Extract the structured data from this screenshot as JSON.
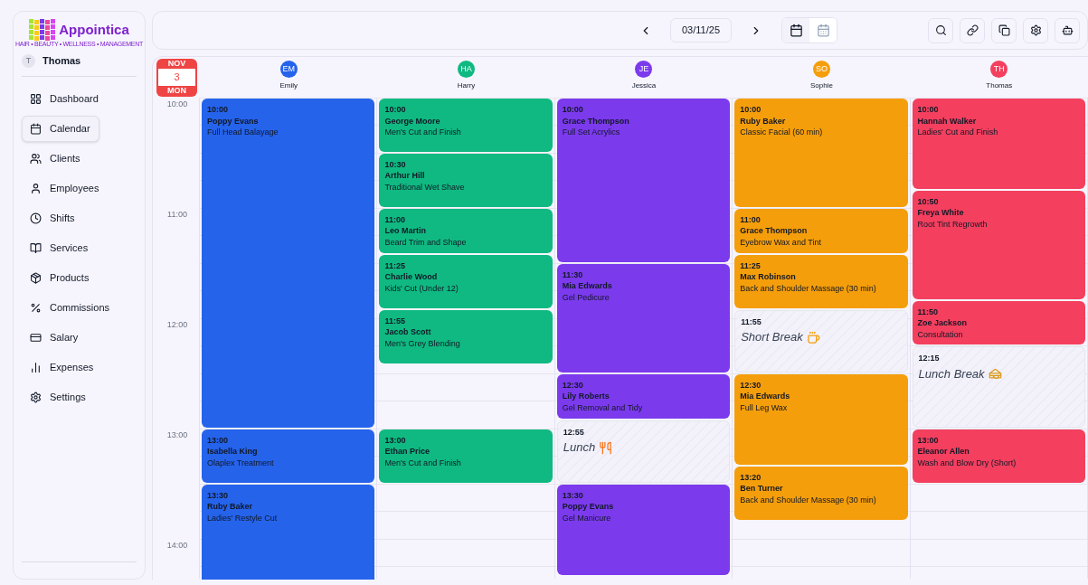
{
  "brand": {
    "name": "Appointica",
    "tagline": "HAIR • BEAUTY • WELLNESS • MANAGEMENT"
  },
  "user": {
    "initial": "T",
    "name": "Thomas"
  },
  "nav": [
    {
      "label": "Dashboard",
      "selected": false
    },
    {
      "label": "Calendar",
      "selected": true
    },
    {
      "label": "Clients",
      "selected": false
    },
    {
      "label": "Employees",
      "selected": false
    },
    {
      "label": "Shifts",
      "selected": false
    },
    {
      "label": "Services",
      "selected": false
    },
    {
      "label": "Products",
      "selected": false
    },
    {
      "label": "Commissions",
      "selected": false
    },
    {
      "label": "Salary",
      "selected": false
    },
    {
      "label": "Expenses",
      "selected": false
    },
    {
      "label": "Settings",
      "selected": false
    }
  ],
  "toolbar": {
    "date": "03/11/25",
    "views": [
      {
        "kind": "day",
        "selected": true
      },
      {
        "kind": "month",
        "selected": false
      }
    ]
  },
  "day_badge": {
    "month": "NOV",
    "day": "3",
    "weekday": "MON"
  },
  "hours": [
    "10:00",
    "11:00",
    "12:00",
    "13:00",
    "14:00"
  ],
  "employees": [
    {
      "initials": "EM",
      "name": "Emily",
      "color": "#2563eb",
      "events": [
        {
          "kind": "appointment",
          "time": "10:00",
          "client": "Poppy Evans",
          "service": "Full Head Balayage"
        },
        {
          "kind": "appointment",
          "time": "13:00",
          "client": "Isabella King",
          "service": "Olaplex Treatment"
        },
        {
          "kind": "appointment",
          "time": "13:30",
          "client": "Ruby Baker",
          "service": "Ladies' Restyle Cut"
        }
      ]
    },
    {
      "initials": "HA",
      "name": "Harry",
      "color": "#10b981",
      "events": [
        {
          "kind": "appointment",
          "time": "10:00",
          "client": "George Moore",
          "service": "Men's Cut and Finish"
        },
        {
          "kind": "appointment",
          "time": "10:30",
          "client": "Arthur Hill",
          "service": "Traditional Wet Shave"
        },
        {
          "kind": "appointment",
          "time": "11:00",
          "client": "Leo Martin",
          "service": "Beard Trim and Shape"
        },
        {
          "kind": "appointment",
          "time": "11:25",
          "client": "Charlie Wood",
          "service": "Kids' Cut (Under 12)"
        },
        {
          "kind": "appointment",
          "time": "11:55",
          "client": "Jacob Scott",
          "service": "Men's Grey Blending"
        },
        {
          "kind": "appointment",
          "time": "13:00",
          "client": "Ethan Price",
          "service": "Men's Cut and Finish"
        }
      ]
    },
    {
      "initials": "JE",
      "name": "Jessica",
      "color": "#7c3aed",
      "events": [
        {
          "kind": "appointment",
          "time": "10:00",
          "client": "Grace Thompson",
          "service": "Full Set Acrylics"
        },
        {
          "kind": "appointment",
          "time": "11:30",
          "client": "Mia Edwards",
          "service": "Gel Pedicure"
        },
        {
          "kind": "appointment",
          "time": "12:30",
          "client": "Lily Roberts",
          "service": "Gel Removal and Tidy"
        },
        {
          "kind": "cutlery",
          "time": "12:55",
          "label": "Lunch"
        },
        {
          "kind": "appointment",
          "time": "13:30",
          "client": "Poppy Evans",
          "service": "Gel Manicure"
        }
      ]
    },
    {
      "initials": "SO",
      "name": "Sophie",
      "color": "#f59e0b",
      "events": [
        {
          "kind": "appointment",
          "time": "10:00",
          "client": "Ruby Baker",
          "service": "Classic Facial (60 min)"
        },
        {
          "kind": "appointment",
          "time": "11:00",
          "client": "Grace Thompson",
          "service": "Eyebrow Wax and Tint"
        },
        {
          "kind": "appointment",
          "time": "11:25",
          "client": "Max Robinson",
          "service": "Back and Shoulder Massage (30 min)"
        },
        {
          "kind": "coffee",
          "time": "11:55",
          "label": "Short Break"
        },
        {
          "kind": "appointment",
          "time": "12:30",
          "client": "Mia Edwards",
          "service": "Full Leg Wax"
        },
        {
          "kind": "appointment",
          "time": "13:20",
          "client": "Ben Turner",
          "service": "Back and Shoulder Massage (30 min)"
        }
      ]
    },
    {
      "initials": "TH",
      "name": "Thomas",
      "color": "#f43f5e",
      "events": [
        {
          "kind": "appointment",
          "time": "10:00",
          "client": "Hannah Walker",
          "service": "Ladies' Cut and Finish"
        },
        {
          "kind": "appointment",
          "time": "10:50",
          "client": "Freya White",
          "service": "Root Tint Regrowth"
        },
        {
          "kind": "appointment",
          "time": "11:50",
          "client": "Zoe Jackson",
          "service": "Consultation"
        },
        {
          "kind": "sandwich",
          "time": "12:15",
          "label": "Lunch Break"
        },
        {
          "kind": "appointment",
          "time": "13:00",
          "client": "Eleanor Allen",
          "service": "Wash and Blow Dry (Short)"
        }
      ]
    }
  ]
}
